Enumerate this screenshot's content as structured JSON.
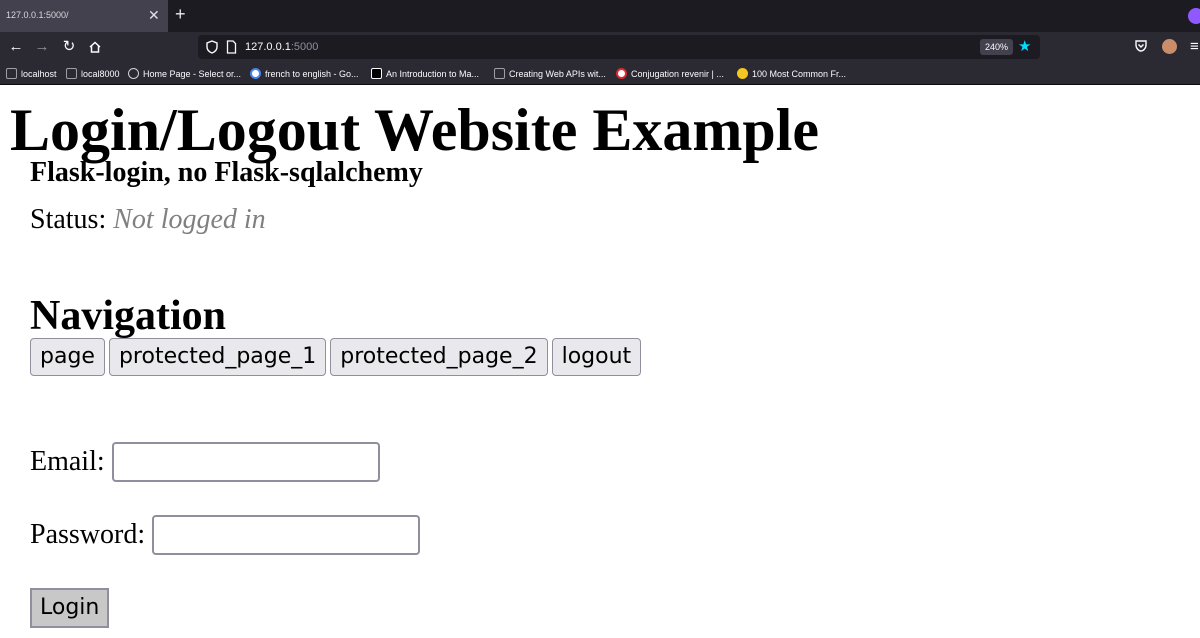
{
  "browser": {
    "tab_title": "127.0.0.1:5000/",
    "tab_close": "✕",
    "new_tab": "+",
    "back": "←",
    "forward": "→",
    "reload": "↻",
    "url_host": "127.0.0.1",
    "url_port": ":5000",
    "zoom": "240%",
    "bookmark_star": "★",
    "menu": "≡",
    "bookmarks": [
      {
        "label": "localhost",
        "icon_color": "#9e9ea8"
      },
      {
        "label": "local8000",
        "icon_color": "#9e9ea8"
      },
      {
        "label": "Home Page - Select or...",
        "icon_color": "#cfcfd8"
      },
      {
        "label": "french to english - Go...",
        "icon_color": "#4285f4"
      },
      {
        "label": "An Introduction to Ma...",
        "icon_color": "#000000"
      },
      {
        "label": "Creating Web APIs wit...",
        "icon_color": "#9e9ea8"
      },
      {
        "label": "Conjugation revenir | ...",
        "icon_color": "#e3262f"
      },
      {
        "label": "100 Most Common Fr...",
        "icon_color": "#f3c623"
      }
    ]
  },
  "page": {
    "title": "Login/Logout Website Example",
    "subtitle": "Flask-login, no Flask-sqlalchemy",
    "status_label": "Status:",
    "status_value": "Not logged in",
    "nav_heading": "Navigation",
    "nav_buttons": [
      "page",
      "protected_page_1",
      "protected_page_2",
      "logout"
    ],
    "email_label": "Email:",
    "email_value": "",
    "password_label": "Password:",
    "password_value": "",
    "login_button": "Login"
  }
}
